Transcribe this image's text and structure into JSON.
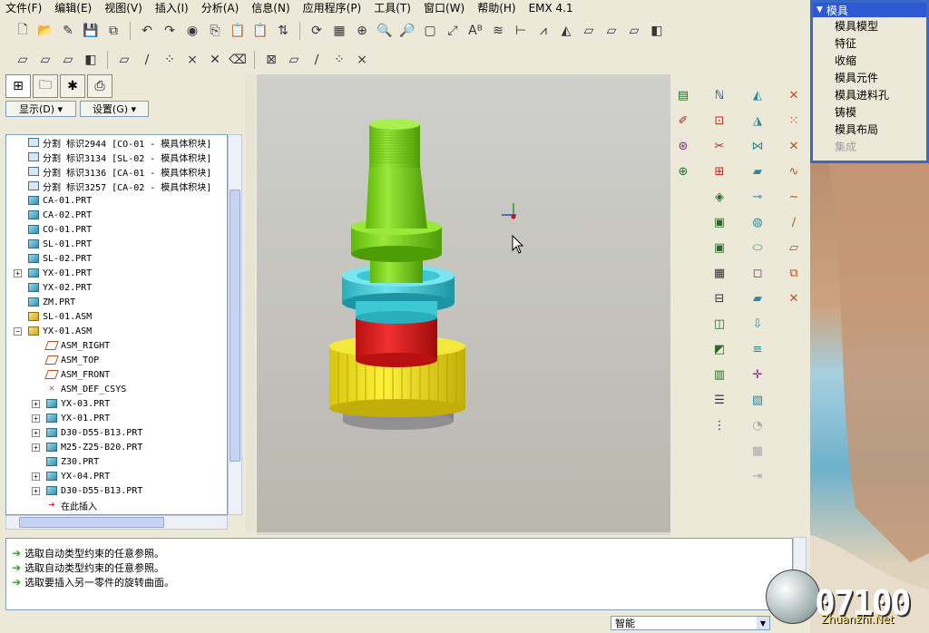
{
  "menubar": [
    "文件(F)",
    "编辑(E)",
    "视图(V)",
    "插入(I)",
    "分析(A)",
    "信息(N)",
    "应用程序(P)",
    "工具(T)",
    "窗口(W)",
    "帮助(H)",
    "EMX 4.1"
  ],
  "left_panel": {
    "show_button": "显示(D) ▾",
    "settings_button": "设置(G) ▾"
  },
  "tree": [
    {
      "kind": "cut",
      "label": "分割 标识2944 [CO-01 - 模具体积块]",
      "indent": 1,
      "expand": ""
    },
    {
      "kind": "cut",
      "label": "分割 标识3134 [SL-02 - 模具体积块]",
      "indent": 1,
      "expand": ""
    },
    {
      "kind": "cut",
      "label": "分割 标识3136 [CA-01 - 模具体积块]",
      "indent": 1,
      "expand": ""
    },
    {
      "kind": "cut",
      "label": "分割 标识3257 [CA-02 - 模具体积块]",
      "indent": 1,
      "expand": ""
    },
    {
      "kind": "part",
      "label": "CA-01.PRT",
      "indent": 1,
      "expand": ""
    },
    {
      "kind": "part",
      "label": "CA-02.PRT",
      "indent": 1,
      "expand": ""
    },
    {
      "kind": "part",
      "label": "CO-01.PRT",
      "indent": 1,
      "expand": ""
    },
    {
      "kind": "part",
      "label": "SL-01.PRT",
      "indent": 1,
      "expand": ""
    },
    {
      "kind": "part",
      "label": "SL-02.PRT",
      "indent": 1,
      "expand": ""
    },
    {
      "kind": "part",
      "label": "YX-01.PRT",
      "indent": 1,
      "expand": "+"
    },
    {
      "kind": "part",
      "label": "YX-02.PRT",
      "indent": 1,
      "expand": ""
    },
    {
      "kind": "part",
      "label": "ZM.PRT",
      "indent": 1,
      "expand": ""
    },
    {
      "kind": "asm",
      "label": "SL-01.ASM",
      "indent": 1,
      "expand": ""
    },
    {
      "kind": "asm",
      "label": "YX-01.ASM",
      "indent": 1,
      "expand": "−"
    },
    {
      "kind": "plane",
      "label": "ASM_RIGHT",
      "indent": 2,
      "expand": ""
    },
    {
      "kind": "plane",
      "label": "ASM_TOP",
      "indent": 2,
      "expand": ""
    },
    {
      "kind": "plane",
      "label": "ASM_FRONT",
      "indent": 2,
      "expand": ""
    },
    {
      "kind": "csys",
      "label": "ASM_DEF_CSYS",
      "indent": 2,
      "expand": ""
    },
    {
      "kind": "part",
      "label": "YX-03.PRT",
      "indent": 2,
      "expand": "+"
    },
    {
      "kind": "part",
      "label": "YX-01.PRT",
      "indent": 2,
      "expand": "+"
    },
    {
      "kind": "part",
      "label": "D30-D55-B13.PRT",
      "indent": 2,
      "expand": "+"
    },
    {
      "kind": "part",
      "label": "M25-Z25-B20.PRT",
      "indent": 2,
      "expand": "+"
    },
    {
      "kind": "part",
      "label": "Z30.PRT",
      "indent": 2,
      "expand": ""
    },
    {
      "kind": "part",
      "label": "YX-04.PRT",
      "indent": 2,
      "expand": "+"
    },
    {
      "kind": "part",
      "label": "D30-D55-B13.PRT",
      "indent": 2,
      "expand": "+"
    },
    {
      "kind": "ins",
      "label": "在此插入",
      "indent": 2,
      "expand": ""
    }
  ],
  "messages": [
    "选取自动类型约束的任意参照。",
    "选取自动类型约束的任意参照。",
    "选取要插入另一零件的旋转曲面。"
  ],
  "status": {
    "filter": "智能"
  },
  "mold_menu": {
    "title": "模具",
    "items": [
      {
        "label": "模具模型",
        "enabled": true
      },
      {
        "label": "特征",
        "enabled": true
      },
      {
        "label": "收缩",
        "enabled": true
      },
      {
        "label": "模具元件",
        "enabled": true
      },
      {
        "label": "模具进料孔",
        "enabled": true
      },
      {
        "label": "铸模",
        "enabled": true
      },
      {
        "label": "模具布局",
        "enabled": true
      },
      {
        "label": "集成",
        "enabled": false
      }
    ]
  },
  "watermark": {
    "counter": "07100",
    "site": "Zhuanzhi.Net"
  },
  "colors": {
    "shaft_green": "#7bd41c",
    "collar_cyan": "#3ec8d6",
    "body_red": "#e01818",
    "gear_yellow": "#f2e419",
    "base_grey": "#a9a9ad",
    "menu_header": "#2d5ad2"
  }
}
